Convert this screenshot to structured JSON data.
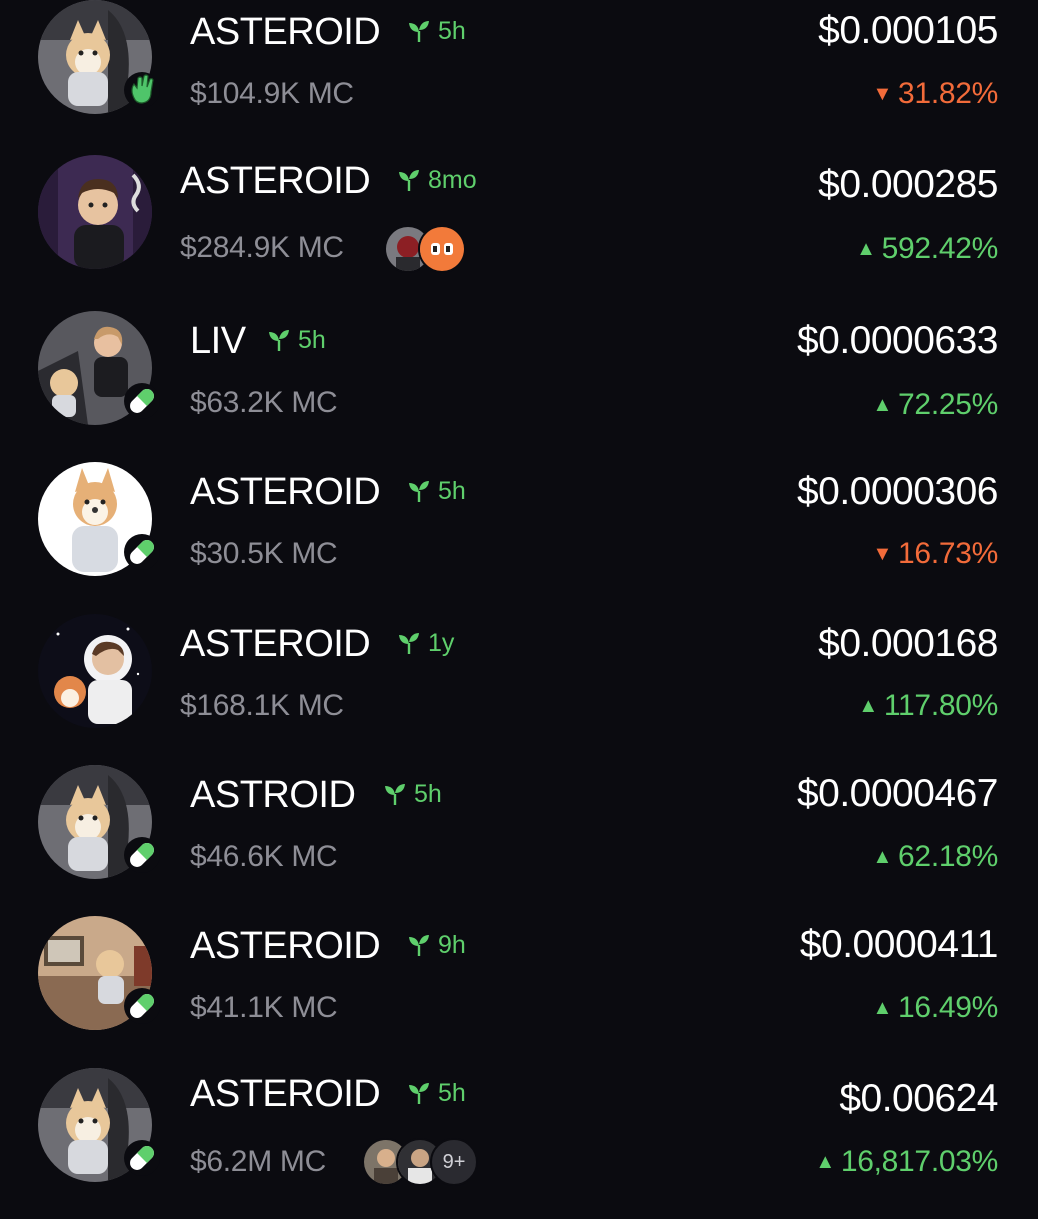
{
  "colors": {
    "background": "#0b0b10",
    "positive": "#5fcf6c",
    "negative": "#f26b3a",
    "muted": "#8e8e96"
  },
  "tokens": [
    {
      "name": "ASTEROID",
      "age": "5h",
      "market_cap": "$104.9K MC",
      "price": "$0.000105",
      "change": "31.82%",
      "direction": "down",
      "arrow": "▼",
      "badge": "wave-hand-icon"
    },
    {
      "name": "ASTEROID",
      "age": "8mo",
      "market_cap": "$284.9K MC",
      "price": "$0.000285",
      "change": "592.42%",
      "direction": "up",
      "arrow": "▲",
      "badge": "",
      "holder_count": ""
    },
    {
      "name": "LIV",
      "age": "5h",
      "market_cap": "$63.2K MC",
      "price": "$0.0000633",
      "change": "72.25%",
      "direction": "up",
      "arrow": "▲",
      "badge": "pill-icon"
    },
    {
      "name": "ASTEROID",
      "age": "5h",
      "market_cap": "$30.5K MC",
      "price": "$0.0000306",
      "change": "16.73%",
      "direction": "down",
      "arrow": "▼",
      "badge": "pill-icon"
    },
    {
      "name": "ASTEROID",
      "age": "1y",
      "market_cap": "$168.1K MC",
      "price": "$0.000168",
      "change": "117.80%",
      "direction": "up",
      "arrow": "▲",
      "badge": ""
    },
    {
      "name": "ASTROID",
      "age": "5h",
      "market_cap": "$46.6K MC",
      "price": "$0.0000467",
      "change": "62.18%",
      "direction": "up",
      "arrow": "▲",
      "badge": "pill-icon"
    },
    {
      "name": "ASTEROID",
      "age": "9h",
      "market_cap": "$41.1K MC",
      "price": "$0.0000411",
      "change": "16.49%",
      "direction": "up",
      "arrow": "▲",
      "badge": "pill-icon"
    },
    {
      "name": "ASTEROID",
      "age": "5h",
      "market_cap": "$6.2M MC",
      "price": "$0.00624",
      "change": "16,817.03%",
      "direction": "up",
      "arrow": "▲",
      "badge": "pill-icon",
      "holder_count": "9+"
    }
  ]
}
